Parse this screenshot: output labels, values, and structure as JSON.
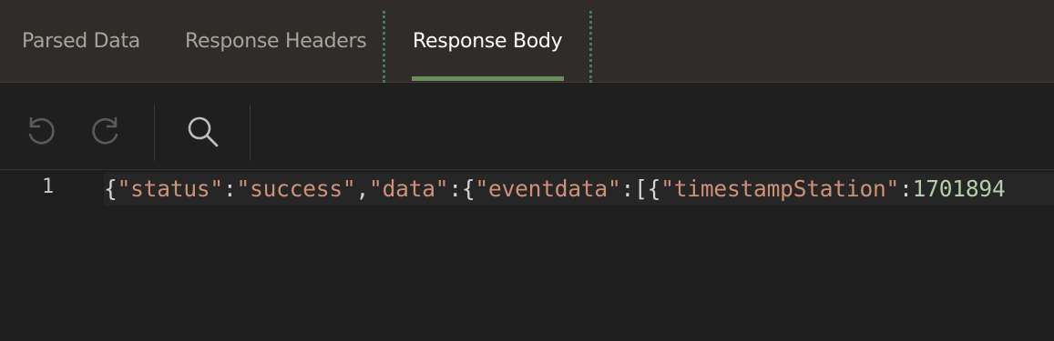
{
  "tabs": [
    {
      "label": "Parsed Data",
      "active": false
    },
    {
      "label": "Response Headers",
      "active": false
    },
    {
      "label": "Response Body",
      "active": true
    }
  ],
  "toolbar": {
    "undo_icon": "undo-icon",
    "redo_icon": "redo-icon",
    "search_icon": "search-icon"
  },
  "editor": {
    "line_number": "1",
    "tokens": [
      {
        "t": "p",
        "v": "{"
      },
      {
        "t": "s",
        "v": "\"status\""
      },
      {
        "t": "p",
        "v": ":"
      },
      {
        "t": "s",
        "v": "\"success\""
      },
      {
        "t": "p",
        "v": ","
      },
      {
        "t": "s",
        "v": "\"data\""
      },
      {
        "t": "p",
        "v": ":{"
      },
      {
        "t": "s",
        "v": "\"eventdata\""
      },
      {
        "t": "p",
        "v": ":[{"
      },
      {
        "t": "s",
        "v": "\"timestampStation\""
      },
      {
        "t": "p",
        "v": ":"
      },
      {
        "t": "n",
        "v": "1701894"
      }
    ]
  },
  "colors": {
    "active_tab_underline": "#6a8f5f",
    "string": "#ce9178",
    "number": "#b5cea8",
    "punctuation": "#d4d4d4"
  }
}
